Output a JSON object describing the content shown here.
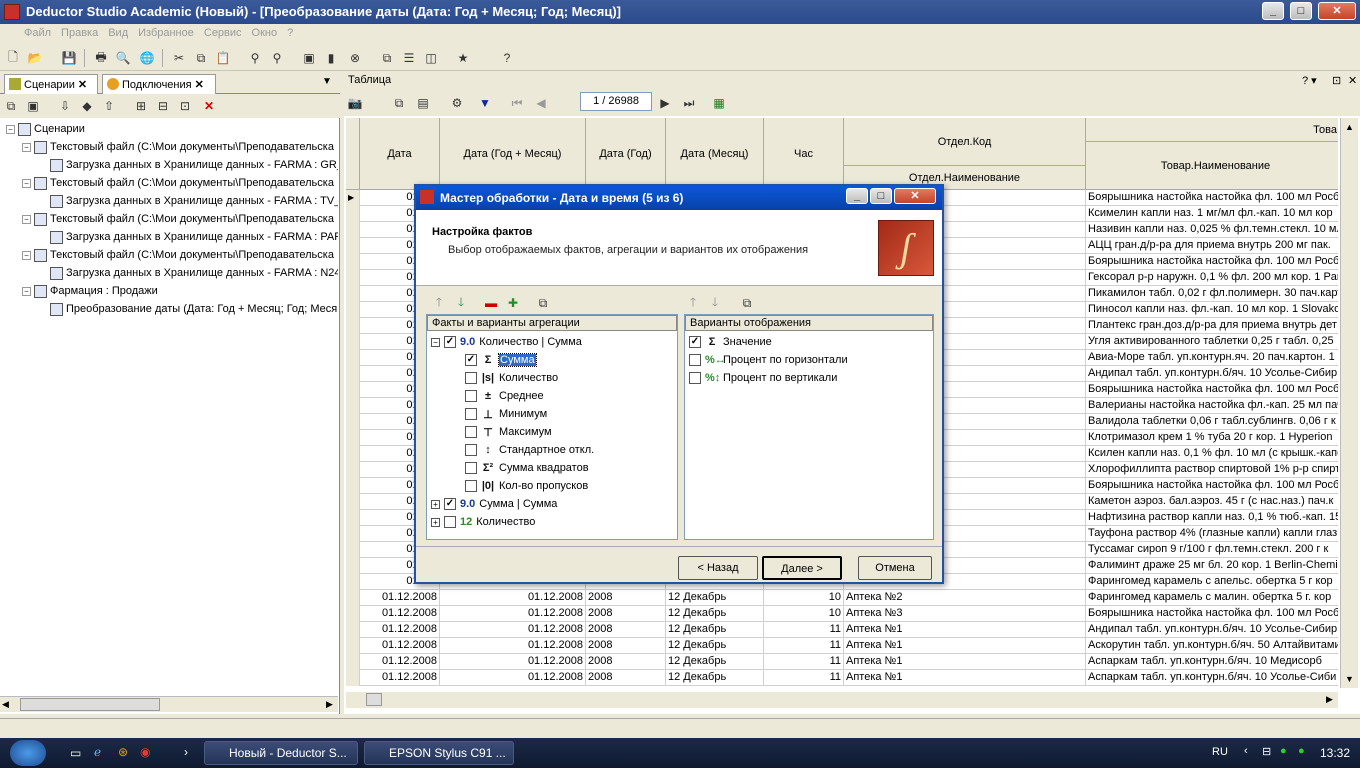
{
  "window": {
    "title": "Deductor Studio Academic (Новый) - [Преобразование даты (Дата: Год + Месяц; Год; Месяц)]"
  },
  "menu": [
    "Файл",
    "Правка",
    "Вид",
    "Избранное",
    "Сервис",
    "Окно",
    "?"
  ],
  "left_tabs": [
    {
      "label": "Сценарии"
    },
    {
      "label": "Подключения"
    }
  ],
  "tree": [
    {
      "level": 0,
      "label": "Сценарии"
    },
    {
      "level": 1,
      "label": "Текстовый файл (C:\\Мои документы\\Преподавательска"
    },
    {
      "level": 2,
      "label": "Загрузка данных в Хранилище данных - FARMA : GR_"
    },
    {
      "level": 1,
      "label": "Текстовый файл (C:\\Мои документы\\Преподавательска"
    },
    {
      "level": 2,
      "label": "Загрузка данных в Хранилище данных - FARMA : TV_"
    },
    {
      "level": 1,
      "label": "Текстовый файл (C:\\Мои документы\\Преподавательска"
    },
    {
      "level": 2,
      "label": "Загрузка данных в Хранилище данных - FARMA : PAF"
    },
    {
      "level": 1,
      "label": "Текстовый файл (C:\\Мои документы\\Преподавательска"
    },
    {
      "level": 2,
      "label": "Загрузка данных в Хранилище данных - FARMA : N24"
    },
    {
      "level": 1,
      "label": "Фармация : Продажи"
    },
    {
      "level": 2,
      "label": "Преобразование даты (Дата: Год + Месяц; Год; Меся"
    }
  ],
  "table_panel": {
    "title": "Таблица",
    "pager": "1 / 26988"
  },
  "columns": {
    "date": "Дата",
    "ym": "Дата (Год + Месяц)",
    "year": "Дата (Год)",
    "month": "Дата (Месяц)",
    "hour": "Час",
    "dept_code": "Отдел.Код",
    "dept_name": "Отдел.Наименование",
    "goods_top": "Това",
    "goods_name": "Товар.Наименование"
  },
  "rows": [
    {
      "d": "01.12.",
      "p": "Боярышника настойка настойка фл. 100 мл Росб"
    },
    {
      "d": "01.12.",
      "p": "Ксимелин капли наз. 1 мг/мл фл.-кап. 10 мл кор"
    },
    {
      "d": "01.12.",
      "p": "Називин капли наз. 0,025 % фл.темн.стекл. 10 мл"
    },
    {
      "d": "01.12.",
      "p": "АЦЦ гран.д/р-ра для приема внутрь 200 мг пак."
    },
    {
      "d": "01.12.",
      "p": "Боярышника настойка настойка фл. 100 мл Росб"
    },
    {
      "d": "01.12.",
      "p": "Гексорал р-р наружн. 0,1 % фл. 200 мл кор. 1 Parl"
    },
    {
      "d": "01.12.",
      "p": "Пикамилон табл. 0,02 г фл.полимерн. 30 пач.карт"
    },
    {
      "d": "01.12.",
      "p": "Пиносол капли наз. фл.-кап. 10 мл кор. 1 Slovako"
    },
    {
      "d": "01.12.",
      "p": "Плантекс гран.доз.д/р-ра для приема внутрь дет"
    },
    {
      "d": "01.12.",
      "p": "Угля активированного таблетки 0,25 г табл. 0,25"
    },
    {
      "d": "01.12.",
      "p": "Авиа-Море табл. уп.контурн.яч. 20 пач.картон. 1 M"
    },
    {
      "d": "01.12.",
      "p": "Андипал табл. уп.контурн.б/яч. 10 Усолье-Сибир"
    },
    {
      "d": "01.12.",
      "p": "Боярышника настойка настойка фл. 100 мл Росб"
    },
    {
      "d": "01.12.",
      "p": "Валерианы настойка настойка фл.-кап. 25 мл пач"
    },
    {
      "d": "01.12.",
      "p": "Валидола таблетки 0,06 г табл.сублингв. 0,06 г к"
    },
    {
      "d": "01.12.",
      "p": "Клотримазол крем 1 % туба 20 г кор. 1 Hyperion"
    },
    {
      "d": "01.12.",
      "p": "Ксилен капли наз. 0,1 % фл. 10 мл (с крышк.-капе"
    },
    {
      "d": "01.12.",
      "p": "Хлорофиллипта раствор спиртовой 1% р-р спирт."
    },
    {
      "d": "01.12.",
      "p": "Боярышника настойка настойка фл. 100 мл Росб"
    },
    {
      "d": "01.12.",
      "p": "Каметон аэроз. бал.аэроз. 45 г (с нас.наз.) пач.к"
    },
    {
      "d": "01.12.",
      "p": "Нафтизина раствор капли наз. 0,1 % тюб.-кап. 15"
    },
    {
      "d": "01.12.",
      "p": "Тауфона раствор 4% (глазные капли) капли глаз"
    },
    {
      "d": "01.12.",
      "p": "Туссамаг сироп 9 г/100 г фл.темн.стекл. 200 г к"
    },
    {
      "d": "01.12.",
      "p": "Фалиминт драже 25 мг бл. 20 кор. 1 Berlin-Chemi"
    },
    {
      "d": "01.12.",
      "p": "Фарингомед карамель с апельс. обертка 5 г кор"
    },
    {
      "d": "01.12.2008",
      "ym": "01.12.2008",
      "y": "2008",
      "m": "12 Декабрь",
      "h": "10",
      "dep": "Аптека №2",
      "p": "Фарингомед карамель с малин. обертка 5 г. кор"
    },
    {
      "d": "01.12.2008",
      "ym": "01.12.2008",
      "y": "2008",
      "m": "12 Декабрь",
      "h": "10",
      "dep": "Аптека №3",
      "p": "Боярышника настойка настойка фл. 100 мл Росб"
    },
    {
      "d": "01.12.2008",
      "ym": "01.12.2008",
      "y": "2008",
      "m": "12 Декабрь",
      "h": "11",
      "dep": "Аптека №1",
      "p": "Андипал табл. уп.контурн.б/яч. 10 Усолье-Сибир"
    },
    {
      "d": "01.12.2008",
      "ym": "01.12.2008",
      "y": "2008",
      "m": "12 Декабрь",
      "h": "11",
      "dep": "Аптека №1",
      "p": "Аскорутин табл. уп.контурн.б/яч. 50 Алтайвитамин"
    },
    {
      "d": "01.12.2008",
      "ym": "01.12.2008",
      "y": "2008",
      "m": "12 Декабрь",
      "h": "11",
      "dep": "Аптека №1",
      "p": "Аспаркам табл. уп.контурн.б/яч. 10 Медисорб"
    },
    {
      "d": "01.12.2008",
      "ym": "01.12.2008",
      "y": "2008",
      "m": "12 Декабрь",
      "h": "11",
      "dep": "Аптека №1",
      "p": "Аспаркам табл. уп.контурн.б/яч. 10 Усолье-Сиби"
    }
  ],
  "dialog": {
    "title": "Мастер обработки - Дата и время (5 из 6)",
    "heading": "Настройка фактов",
    "subheading": "Выбор отображаемых фактов, агрегации и вариантов их отображения",
    "left_header": "Факты и варианты агрегации",
    "right_header": "Варианты отображения",
    "facts": [
      {
        "level": 0,
        "tag": "9.0",
        "label": "Количество | Сумма",
        "checked": true,
        "expand": "−"
      },
      {
        "level": 1,
        "sym": "Σ",
        "label": "Сумма",
        "checked": true,
        "selected": true
      },
      {
        "level": 1,
        "sym": "|s|",
        "label": "Количество",
        "checked": false
      },
      {
        "level": 1,
        "sym": "±",
        "label": "Среднее",
        "checked": false
      },
      {
        "level": 1,
        "sym": "⊥",
        "label": "Минимум",
        "checked": false
      },
      {
        "level": 1,
        "sym": "⊤",
        "label": "Максимум",
        "checked": false
      },
      {
        "level": 1,
        "sym": "↕",
        "label": "Стандартное откл.",
        "checked": false
      },
      {
        "level": 1,
        "sym": "Σ²",
        "label": "Сумма квадратов",
        "checked": false
      },
      {
        "level": 1,
        "sym": "|0|",
        "label": "Кол-во пропусков",
        "checked": false
      },
      {
        "level": 0,
        "tag": "9.0",
        "label": "Сумма | Сумма",
        "checked": true,
        "expand": "+"
      },
      {
        "level": 0,
        "tag": "12",
        "label": "Количество",
        "checked": false,
        "expand": "+"
      }
    ],
    "views": [
      {
        "sym": "Σ",
        "label": "Значение",
        "checked": true
      },
      {
        "sym": "%↔",
        "label": "Процент по горизонтали",
        "checked": false
      },
      {
        "sym": "%↕",
        "label": "Процент по вертикали",
        "checked": false
      }
    ],
    "buttons": {
      "back": "< Назад",
      "next": "Далее >",
      "cancel": "Отмена"
    }
  },
  "taskbar": {
    "tasks": [
      "Новый - Deductor S...",
      "EPSON Stylus C91 ..."
    ],
    "lang": "RU",
    "time": "13:32"
  },
  "colors": {
    "accent": "#0a58d8",
    "title": "#2a4a8c"
  }
}
